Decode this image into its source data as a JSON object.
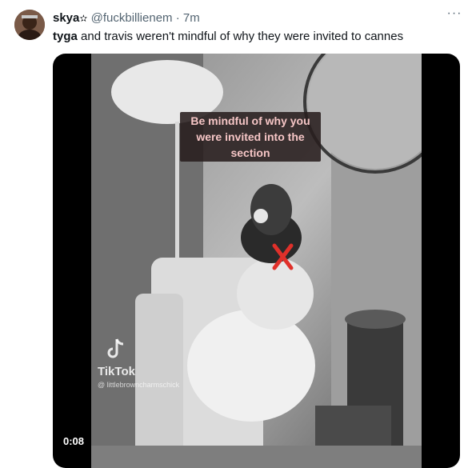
{
  "tweet": {
    "display_name": "skya",
    "star_glyph": "✫",
    "handle": "@fuckbillienem",
    "separator": "·",
    "time": "7m",
    "more_glyph": "···",
    "text_bold": "tyga",
    "text_rest": " and travis weren't mindful of why they were invited to cannes"
  },
  "media": {
    "caption": "Be mindful of why you\nwere invited into the\nsection",
    "tiktok_wordmark": "TikTok",
    "tiktok_username": "@ littlebrowncharmschick",
    "duration": "0:08"
  },
  "colors": {
    "text_primary": "#0f1419",
    "text_secondary": "#536471",
    "caption_text": "#f6c6c6",
    "red_x": "#e0302a"
  }
}
